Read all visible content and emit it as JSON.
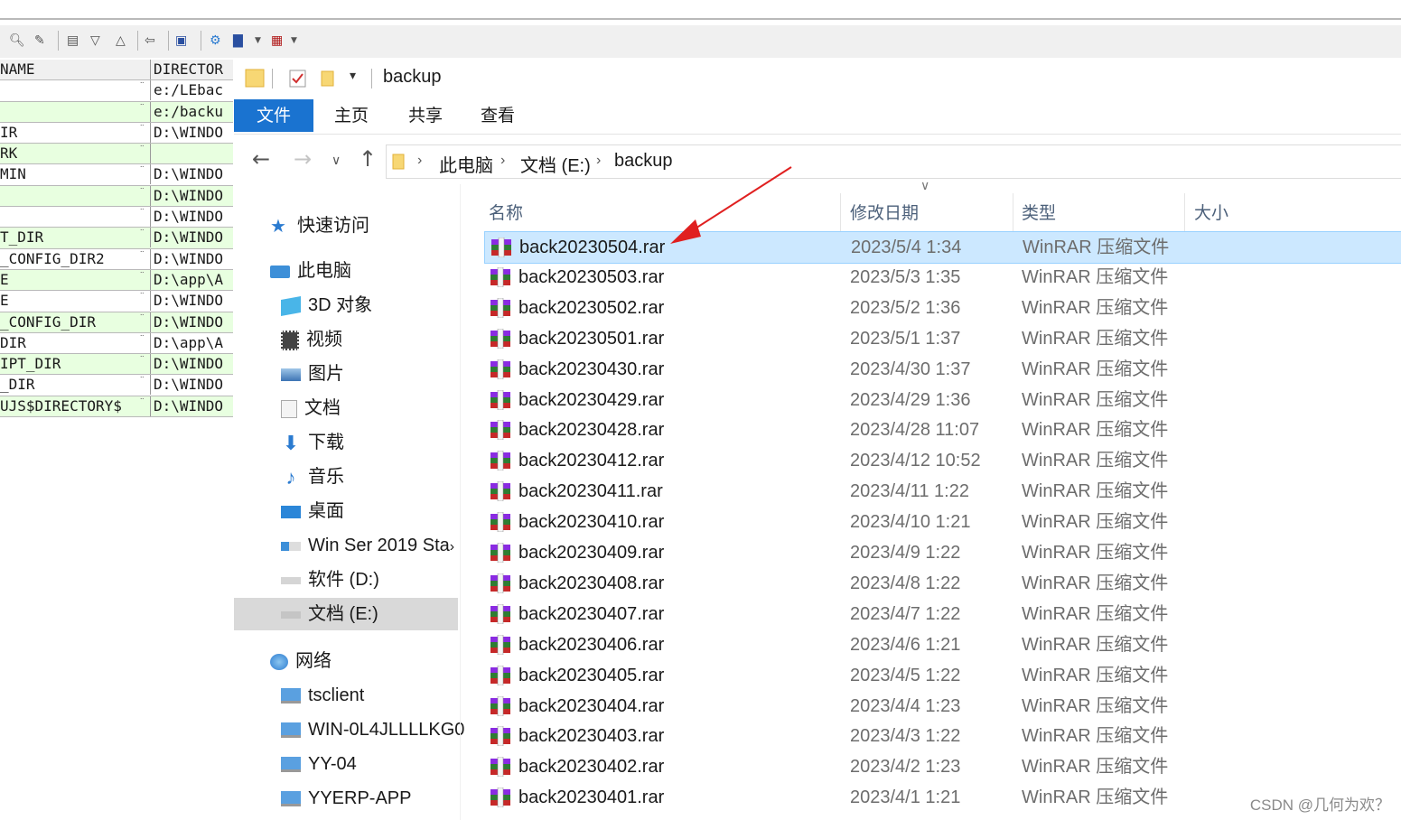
{
  "grid": {
    "header": {
      "name": "NAME",
      "dir": "DIRECTOR"
    },
    "rows": [
      {
        "name": "",
        "dir": "e:/LEbac"
      },
      {
        "name": "",
        "dir": "e:/backu"
      },
      {
        "name": "IR",
        "dir": "D:\\WINDO"
      },
      {
        "name": "RK",
        "dir": ""
      },
      {
        "name": "MIN",
        "dir": "D:\\WINDO"
      },
      {
        "name": "",
        "dir": "D:\\WINDO"
      },
      {
        "name": "",
        "dir": "D:\\WINDO"
      },
      {
        "name": "T_DIR",
        "dir": "D:\\WINDO"
      },
      {
        "name": "_CONFIG_DIR2",
        "dir": "D:\\WINDO"
      },
      {
        "name": "E",
        "dir": "D:\\app\\A"
      },
      {
        "name": "E",
        "dir": "D:\\WINDO"
      },
      {
        "name": "_CONFIG_DIR",
        "dir": "D:\\WINDO"
      },
      {
        "name": "DIR",
        "dir": "D:\\app\\A"
      },
      {
        "name": "IPT_DIR",
        "dir": "D:\\WINDO"
      },
      {
        "name": "_DIR",
        "dir": "D:\\WINDO"
      },
      {
        "name": "UJS$DIRECTORY$",
        "dir": "D:\\WINDO"
      }
    ]
  },
  "explorer": {
    "window_title": "backup",
    "ribbon_tabs": [
      "文件",
      "主页",
      "共享",
      "查看"
    ],
    "breadcrumb": [
      "此电脑",
      "文档 (E:)",
      "backup"
    ],
    "nav": {
      "quick_access": "快速访问",
      "this_pc": "此电脑",
      "objects3d": "3D 对象",
      "videos": "视频",
      "pictures": "图片",
      "documents": "文档",
      "downloads": "下载",
      "music": "音乐",
      "desktop": "桌面",
      "drive_c": "Win Ser 2019 Sta",
      "drive_d": "软件 (D:)",
      "drive_e": "文档 (E:)",
      "network": "网络",
      "net1": "tsclient",
      "net2": "WIN-0L4JLLLLKG0",
      "net3": "YY-04",
      "net4": "YYERP-APP"
    },
    "columns": {
      "name": "名称",
      "date": "修改日期",
      "type": "类型",
      "size": "大小"
    },
    "files": [
      {
        "name": "back20230504.rar",
        "date": "2023/5/4 1:34",
        "type": "WinRAR 压缩文件"
      },
      {
        "name": "back20230503.rar",
        "date": "2023/5/3 1:35",
        "type": "WinRAR 压缩文件"
      },
      {
        "name": "back20230502.rar",
        "date": "2023/5/2 1:36",
        "type": "WinRAR 压缩文件"
      },
      {
        "name": "back20230501.rar",
        "date": "2023/5/1 1:37",
        "type": "WinRAR 压缩文件"
      },
      {
        "name": "back20230430.rar",
        "date": "2023/4/30 1:37",
        "type": "WinRAR 压缩文件"
      },
      {
        "name": "back20230429.rar",
        "date": "2023/4/29 1:36",
        "type": "WinRAR 压缩文件"
      },
      {
        "name": "back20230428.rar",
        "date": "2023/4/28 11:07",
        "type": "WinRAR 压缩文件"
      },
      {
        "name": "back20230412.rar",
        "date": "2023/4/12 10:52",
        "type": "WinRAR 压缩文件"
      },
      {
        "name": "back20230411.rar",
        "date": "2023/4/11 1:22",
        "type": "WinRAR 压缩文件"
      },
      {
        "name": "back20230410.rar",
        "date": "2023/4/10 1:21",
        "type": "WinRAR 压缩文件"
      },
      {
        "name": "back20230409.rar",
        "date": "2023/4/9 1:22",
        "type": "WinRAR 压缩文件"
      },
      {
        "name": "back20230408.rar",
        "date": "2023/4/8 1:22",
        "type": "WinRAR 压缩文件"
      },
      {
        "name": "back20230407.rar",
        "date": "2023/4/7 1:22",
        "type": "WinRAR 压缩文件"
      },
      {
        "name": "back20230406.rar",
        "date": "2023/4/6 1:21",
        "type": "WinRAR 压缩文件"
      },
      {
        "name": "back20230405.rar",
        "date": "2023/4/5 1:22",
        "type": "WinRAR 压缩文件"
      },
      {
        "name": "back20230404.rar",
        "date": "2023/4/4 1:23",
        "type": "WinRAR 压缩文件"
      },
      {
        "name": "back20230403.rar",
        "date": "2023/4/3 1:22",
        "type": "WinRAR 压缩文件"
      },
      {
        "name": "back20230402.rar",
        "date": "2023/4/2 1:23",
        "type": "WinRAR 压缩文件"
      },
      {
        "name": "back20230401.rar",
        "date": "2023/4/1 1:21",
        "type": "WinRAR 压缩文件"
      }
    ],
    "selected_index": 0
  },
  "watermark": "CSDN @几何为欢？",
  "colors": {
    "accent": "#1a73d0",
    "selection": "#cce8ff",
    "grid_alt": "#e8ffe0",
    "annotation_arrow": "#e02020"
  }
}
